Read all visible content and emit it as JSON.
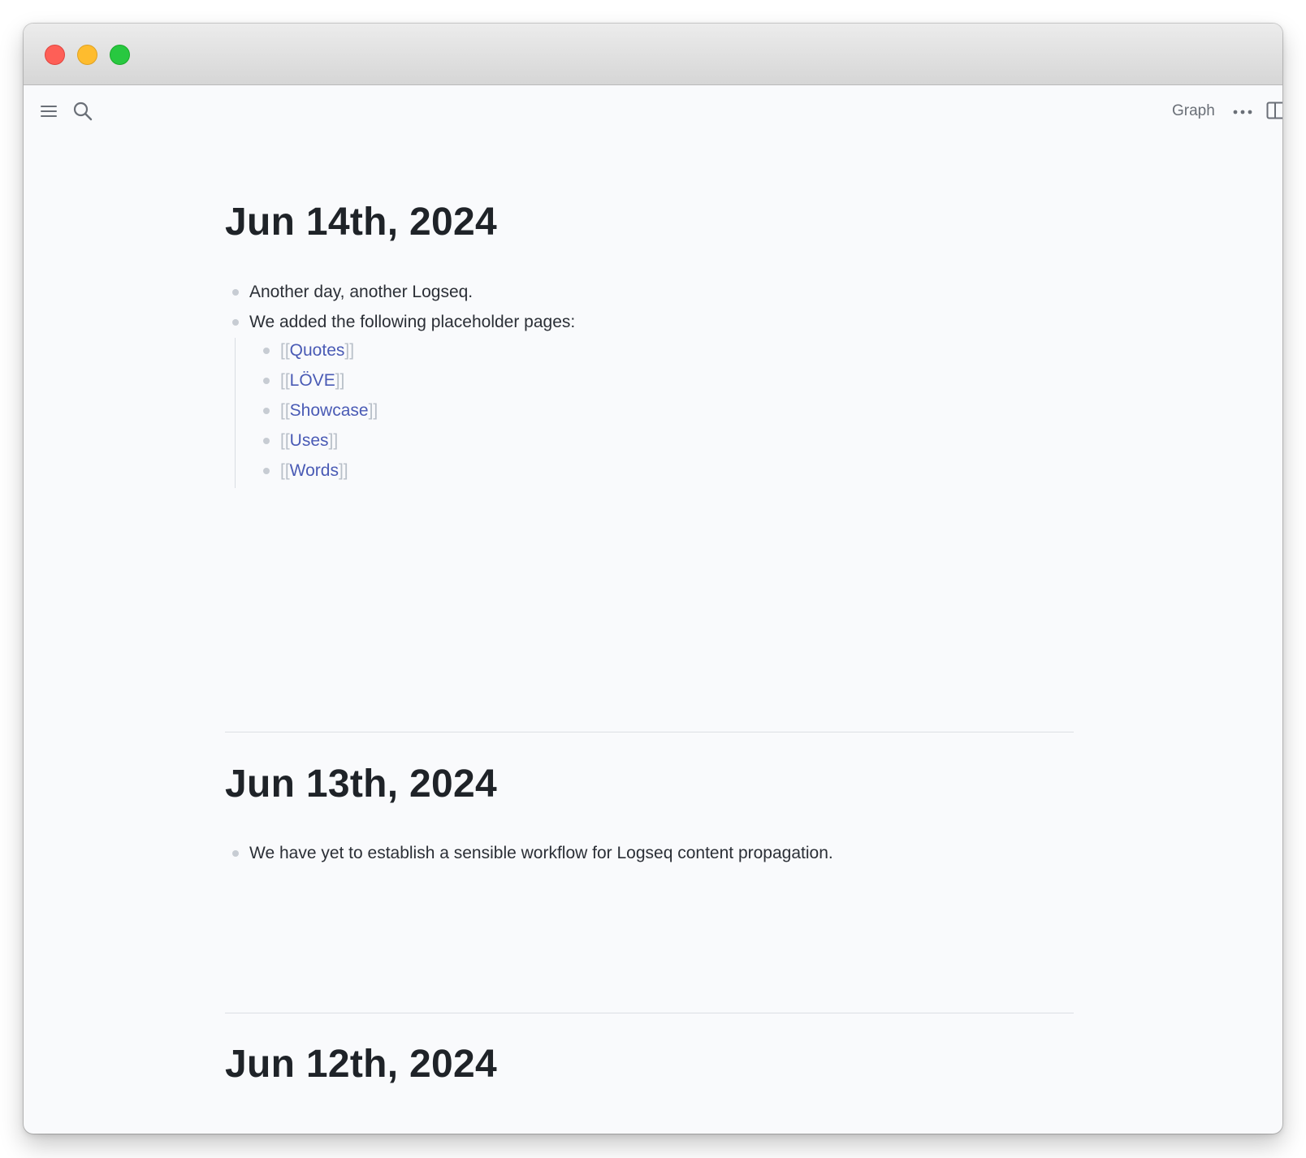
{
  "toolbar": {
    "graph_label": "Graph"
  },
  "journals": [
    {
      "title": "Jun 14th, 2024",
      "blocks": [
        "Another day, another Logseq.",
        "We added the following placeholder pages:"
      ],
      "children": [
        {
          "open": "[[",
          "ref": "Quotes",
          "close": "]]"
        },
        {
          "open": "[[",
          "ref": "LÖVE",
          "close": "]]"
        },
        {
          "open": "[[",
          "ref": "Showcase",
          "close": "]]"
        },
        {
          "open": "[[",
          "ref": "Uses",
          "close": "]]"
        },
        {
          "open": "[[",
          "ref": "Words",
          "close": "]]"
        }
      ]
    },
    {
      "title": "Jun 13th, 2024",
      "blocks": [
        "We have yet to establish a sensible workflow for Logseq content propagation."
      ]
    },
    {
      "title": "Jun 12th, 2024"
    }
  ],
  "colors": {
    "page_ref": "#4a5bb5",
    "bracket": "#b8bfc8",
    "bullet": "#c7ccd3"
  }
}
